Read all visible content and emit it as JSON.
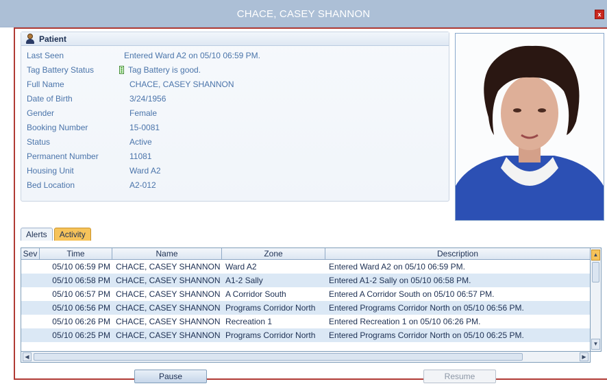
{
  "window": {
    "title": "CHACE, CASEY SHANNON",
    "close_label": "x"
  },
  "patient": {
    "header": "Patient",
    "fields": [
      {
        "label": "Last Seen",
        "value": "Entered Ward A2 on 05/10 06:59 PM."
      },
      {
        "label": "Tag Battery Status",
        "value": "Tag Battery is good."
      },
      {
        "label": "Full Name",
        "value": "CHACE, CASEY SHANNON"
      },
      {
        "label": "Date of Birth",
        "value": "3/24/1956"
      },
      {
        "label": "Gender",
        "value": "Female"
      },
      {
        "label": "Booking Number",
        "value": "15-0081"
      },
      {
        "label": "Status",
        "value": "Active"
      },
      {
        "label": "Permanent Number",
        "value": "11081"
      },
      {
        "label": "Housing Unit",
        "value": "Ward A2"
      },
      {
        "label": "Bed Location",
        "value": "A2-012"
      }
    ]
  },
  "tabs": [
    {
      "label": "Alerts",
      "active": false
    },
    {
      "label": "Activity",
      "active": true
    }
  ],
  "activity": {
    "columns": [
      "Sev",
      "Time",
      "Name",
      "Zone",
      "Description"
    ],
    "rows": [
      {
        "sev": "",
        "time": "05/10 06:59 PM",
        "name": "CHACE, CASEY SHANNON",
        "zone": "Ward A2",
        "description": "Entered Ward A2 on 05/10 06:59 PM."
      },
      {
        "sev": "",
        "time": "05/10 06:58 PM",
        "name": "CHACE, CASEY SHANNON",
        "zone": "A1-2 Sally",
        "description": "Entered A1-2 Sally on 05/10 06:58 PM."
      },
      {
        "sev": "",
        "time": "05/10 06:57 PM",
        "name": "CHACE, CASEY SHANNON",
        "zone": "A Corridor South",
        "description": "Entered A Corridor South on 05/10 06:57 PM."
      },
      {
        "sev": "",
        "time": "05/10 06:56 PM",
        "name": "CHACE, CASEY SHANNON",
        "zone": "Programs Corridor North",
        "description": "Entered Programs Corridor North on 05/10 06:56 PM."
      },
      {
        "sev": "",
        "time": "05/10 06:26 PM",
        "name": "CHACE, CASEY SHANNON",
        "zone": "Recreation 1",
        "description": "Entered Recreation 1 on 05/10 06:26 PM."
      },
      {
        "sev": "",
        "time": "05/10 06:25 PM",
        "name": "CHACE, CASEY SHANNON",
        "zone": "Programs Corridor North",
        "description": "Entered Programs Corridor North on 05/10 06:25 PM."
      }
    ]
  },
  "buttons": {
    "pause": "Pause",
    "resume": "Resume"
  },
  "colors": {
    "titlebar": "#acbfd6",
    "frame_border": "#b03a34",
    "active_tab": "#f6c35a",
    "alt_row": "#dbe8f5",
    "label_text": "#4a74aa"
  },
  "icons": {
    "patient": "person-icon",
    "battery": "battery-icon",
    "close": "close-icon"
  }
}
